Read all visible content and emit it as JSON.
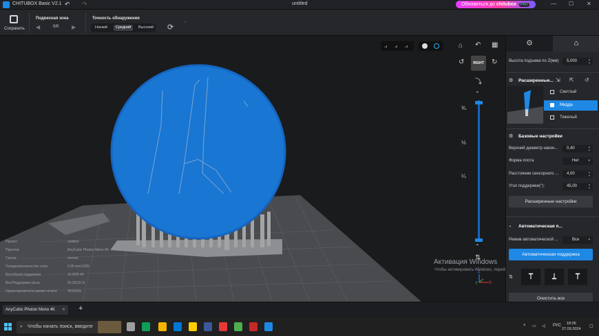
{
  "titlebar": {
    "app_title": "CHITUBOX Basic V2.1",
    "doc_title": "untitled",
    "upgrade_label": "Обновиться до",
    "upgrade_brand": "chitubox",
    "upgrade_badge": "PRO",
    "minimize": "—",
    "maximize": "☐",
    "close": "✕"
  },
  "toolbar": {
    "save_label": "Сохранить",
    "zone_title": "Подвесная зона",
    "zone_count": "0/0",
    "accuracy_title": "Точность обнаружения",
    "accuracy_options": [
      "Низкий",
      "Средний",
      "Высокий"
    ],
    "accuracy_selected": "Средний"
  },
  "viewport": {
    "view_fractions": [
      "¾",
      "½",
      "¼"
    ],
    "right_view_label": "RIGHT",
    "axis_labels": {
      "x": "X",
      "y": "Y",
      "z": "Z"
    },
    "info": [
      {
        "label": "Проект:",
        "value": "untitled"
      },
      {
        "label": "Принтер",
        "value": "AnyCubic Photon Mono 4K"
      },
      {
        "label": "Смола:",
        "value": "normal"
      },
      {
        "label": "Толщина/количество слоя:",
        "value": "0.05 mm/1025"
      },
      {
        "label": "Вес/объем поддержки",
        "value": "16.65/5.43"
      },
      {
        "label": "Вес/Поддержка Цена",
        "value": "65.05/19.11"
      },
      {
        "label": "Ориентировочное время печати",
        "value": "3h10m0s"
      }
    ],
    "watermark_title": "Активация Windows",
    "watermark_text": "Чтобы активировать Windows, перейдите в раздел \"Параметры\"."
  },
  "panel": {
    "lift_height_label": "Высота подъема по Z(мм)",
    "lift_height_value": "5,000",
    "advanced_title": "Расширенные...",
    "density_options": [
      "Светлый",
      "Мидда",
      "Тяжелый"
    ],
    "density_selected": "Мидда",
    "basic_title": "Базовые настройки",
    "basic_rows": [
      {
        "label": "Верхний диаметр након...",
        "value": "0,40"
      },
      {
        "label": "Форма плота",
        "value": "Нет"
      },
      {
        "label": "Расстояние сенсорного ...",
        "value": "4,00"
      },
      {
        "label": "Угол поддержки(°):",
        "value": "45,00"
      }
    ],
    "advanced_settings_button": "Расширенные настройки",
    "auto_title": "Автоматическая п...",
    "auto_mode_label": "Режим автоматической ...",
    "auto_mode_value": "Все",
    "auto_support_button": "Автоматическая поддержка",
    "clear_all_button": "Очистить все"
  },
  "statusbar": {
    "printer_tab": "AnyCubic Photon Mono 4K",
    "add_tab": "+"
  },
  "taskbar": {
    "search_placeholder": "Чтобы начать поиск, введите",
    "lang": "РУС",
    "time": "18:36",
    "date": "27.09.2024"
  },
  "colors": {
    "accent": "#1e88e5",
    "sphere": "#1976d2",
    "plate": "#5a5b5e"
  }
}
